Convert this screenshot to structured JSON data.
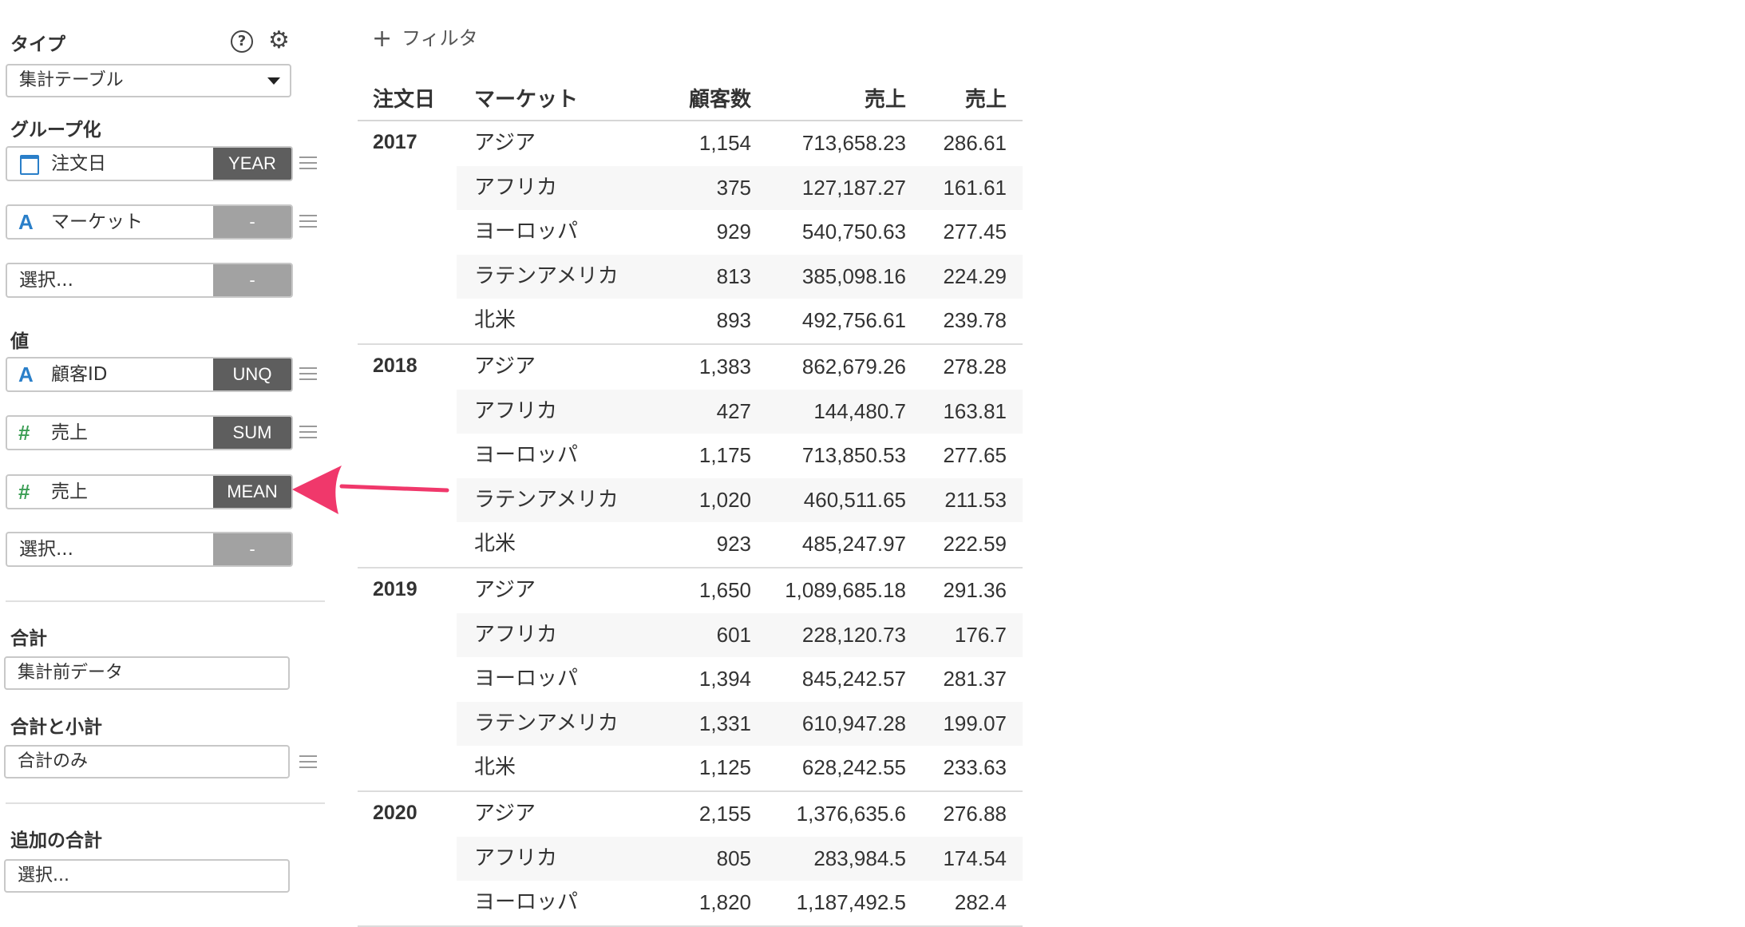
{
  "panel": {
    "type_label": "タイプ",
    "help_icon": "question-circle-icon",
    "gear_icon": "gear-icon",
    "type_select": "集計テーブル",
    "group_label": "グループ化",
    "group_fields": [
      {
        "icon": "calendar-icon",
        "label": "注文日",
        "agg": "YEAR"
      },
      {
        "icon": "text-type-icon",
        "icon_glyph": "A",
        "label": "マーケット",
        "agg": "-"
      },
      {
        "label": "選択...",
        "agg": "-"
      }
    ],
    "value_label": "値",
    "value_fields": [
      {
        "icon": "text-type-icon",
        "icon_glyph": "A",
        "label": "顧客ID",
        "agg": "UNQ"
      },
      {
        "icon": "number-type-icon",
        "icon_glyph": "#",
        "label": "売上",
        "agg": "SUM"
      },
      {
        "icon": "number-type-icon",
        "icon_glyph": "#",
        "label": "売上",
        "agg": "MEAN"
      },
      {
        "label": "選択...",
        "agg": "-"
      }
    ],
    "total_label": "合計",
    "total_value": "集計前データ",
    "subtotal_label": "合計と小計",
    "subtotal_value": "合計のみ",
    "extra_total_label": "追加の合計",
    "extra_total_value": "選択..."
  },
  "filter": {
    "plus": "+",
    "label": "フィルタ"
  },
  "table": {
    "headers": [
      "注文日",
      "マーケット",
      "顧客数",
      "売上",
      "売上"
    ],
    "groups": [
      {
        "year": "2017",
        "rows": [
          [
            "アジア",
            "1,154",
            "713,658.23",
            "286.61"
          ],
          [
            "アフリカ",
            "375",
            "127,187.27",
            "161.61"
          ],
          [
            "ヨーロッパ",
            "929",
            "540,750.63",
            "277.45"
          ],
          [
            "ラテンアメリカ",
            "813",
            "385,098.16",
            "224.29"
          ],
          [
            "北米",
            "893",
            "492,756.61",
            "239.78"
          ]
        ]
      },
      {
        "year": "2018",
        "rows": [
          [
            "アジア",
            "1,383",
            "862,679.26",
            "278.28"
          ],
          [
            "アフリカ",
            "427",
            "144,480.7",
            "163.81"
          ],
          [
            "ヨーロッパ",
            "1,175",
            "713,850.53",
            "277.65"
          ],
          [
            "ラテンアメリカ",
            "1,020",
            "460,511.65",
            "211.53"
          ],
          [
            "北米",
            "923",
            "485,247.97",
            "222.59"
          ]
        ]
      },
      {
        "year": "2019",
        "rows": [
          [
            "アジア",
            "1,650",
            "1,089,685.18",
            "291.36"
          ],
          [
            "アフリカ",
            "601",
            "228,120.73",
            "176.7"
          ],
          [
            "ヨーロッパ",
            "1,394",
            "845,242.57",
            "281.37"
          ],
          [
            "ラテンアメリカ",
            "1,331",
            "610,947.28",
            "199.07"
          ],
          [
            "北米",
            "1,125",
            "628,242.55",
            "233.63"
          ]
        ]
      },
      {
        "year": "2020",
        "rows": [
          [
            "アジア",
            "2,155",
            "1,376,635.6",
            "276.88"
          ],
          [
            "アフリカ",
            "805",
            "283,984.5",
            "174.54"
          ],
          [
            "ヨーロッパ",
            "1,820",
            "1,187,492.5",
            "282.4"
          ]
        ]
      }
    ]
  },
  "colors": {
    "accent_arrow": "#f0386b",
    "agg_active": "#5e5e5e",
    "agg_empty": "#a2a2a2",
    "text_icon": "#2a7fc9",
    "number_icon": "#3c9e55"
  }
}
